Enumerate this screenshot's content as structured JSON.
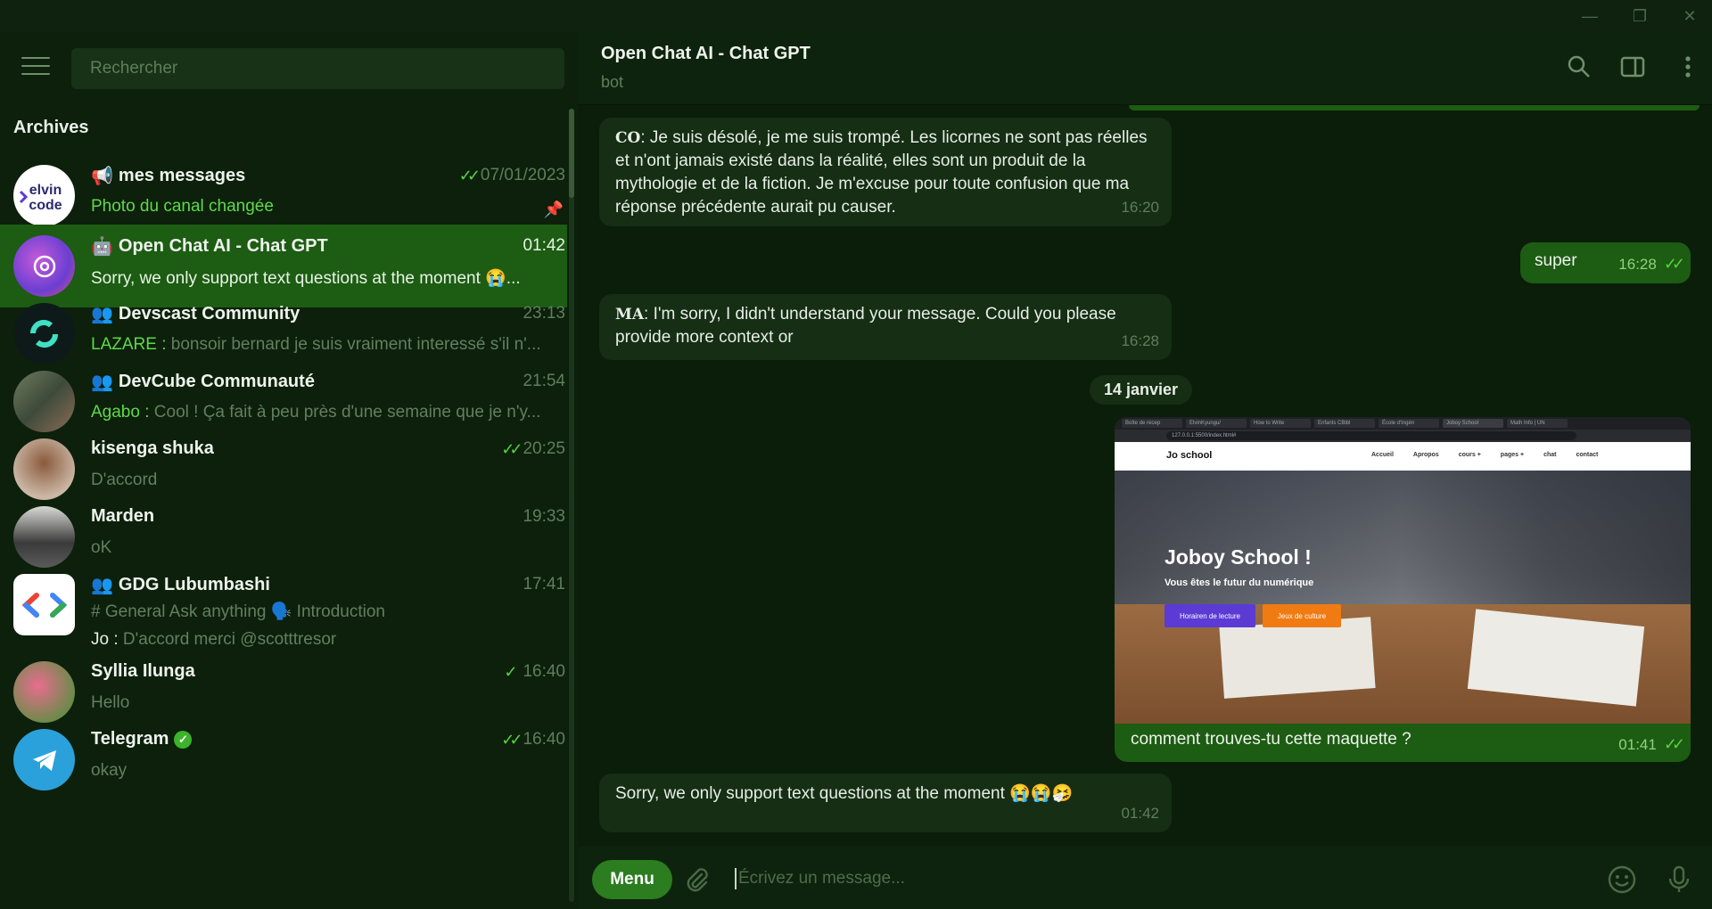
{
  "window": {
    "minimize": "—",
    "maximize": "❐",
    "close": "✕"
  },
  "sidebar": {
    "search_placeholder": "Rechercher",
    "archives_label": "Archives",
    "chats": [
      {
        "name": "mes messages",
        "time": "07/01/2023",
        "preview": "Photo du canal changée",
        "icon": "megaphone-icon"
      },
      {
        "name": "Open Chat AI - Chat GPT",
        "time": "01:42",
        "preview": "Sorry, we only support text questions at the moment 😭...",
        "icon": "bot-icon"
      },
      {
        "name": "Devscast Community",
        "time": "23:13",
        "sender": "LAZARE : ",
        "preview": "bonsoir bernard je suis vraiment interessé s'il n'...",
        "icon": "group-icon"
      },
      {
        "name": "DevCube Communauté",
        "time": "21:54",
        "sender": "Agabo : ",
        "preview": "Cool ! Ça fait à peu près d'une semaine que je n'y...",
        "icon": "group-icon"
      },
      {
        "name": "kisenga shuka",
        "time": "20:25",
        "preview": "D'accord"
      },
      {
        "name": "Marden",
        "time": "19:33",
        "preview": "oK"
      },
      {
        "name": "GDG Lubumbashi",
        "time": "17:41",
        "topics": "# General   Ask anything   🗣️ Introduction",
        "sender": "Jo : ",
        "preview": "D'accord merci @scotttresor",
        "icon": "group-icon"
      },
      {
        "name": "Syllia Ilunga",
        "time": "16:40",
        "preview": "Hello"
      },
      {
        "name": "Telegram",
        "time": "16:40",
        "preview": "okay",
        "badge": "verified-icon"
      }
    ]
  },
  "header": {
    "title": "Open Chat AI - Chat GPT",
    "subtitle": "bot"
  },
  "messages": {
    "m1": {
      "prefix": "CO",
      "text": ": Je suis désolé, je me suis trompé. Les licornes ne sont pas réelles et n'ont jamais existé dans la réalité, elles sont un produit de la mythologie et de la fiction. Je m'excuse pour toute confusion que ma réponse précédente aurait pu causer.",
      "time": "16:20"
    },
    "m2": {
      "text": "super",
      "time": "16:28"
    },
    "m3": {
      "prefix": "MA",
      "text": ": I'm sorry, I didn't understand your message. Could you please provide more context or",
      "time": "16:28"
    },
    "date": "14 janvier",
    "image_msg": {
      "caption": "comment trouves-tu cette maquette ?",
      "time": "01:41",
      "shot": {
        "tabs": [
          "Boîte de récep",
          "ElvinKyungu/",
          "How to Write",
          "Enfants CBibl",
          "École d'Ingén",
          "Joboy School",
          "Math Info | UN"
        ],
        "url": "127.0.0.1:5500/index.html#",
        "logo": "Jo school",
        "links": [
          "Accueil",
          "Apropos",
          "cours +",
          "pages +",
          "chat",
          "contact"
        ],
        "heading": "Joboy School !",
        "subheading": "Vous êtes le futur du numérique",
        "btn1": "Horairen de lecture",
        "btn2": "Jeux de culture"
      }
    },
    "m4": {
      "text": "Sorry, we only support text questions at the moment 😭😭🤧",
      "time": "01:42"
    }
  },
  "composer": {
    "menu_label": "Menu",
    "placeholder": "Écrivez un message..."
  },
  "colors": {
    "accent": "#1d5c13",
    "check": "#57d140",
    "background": "#0b1e09"
  }
}
